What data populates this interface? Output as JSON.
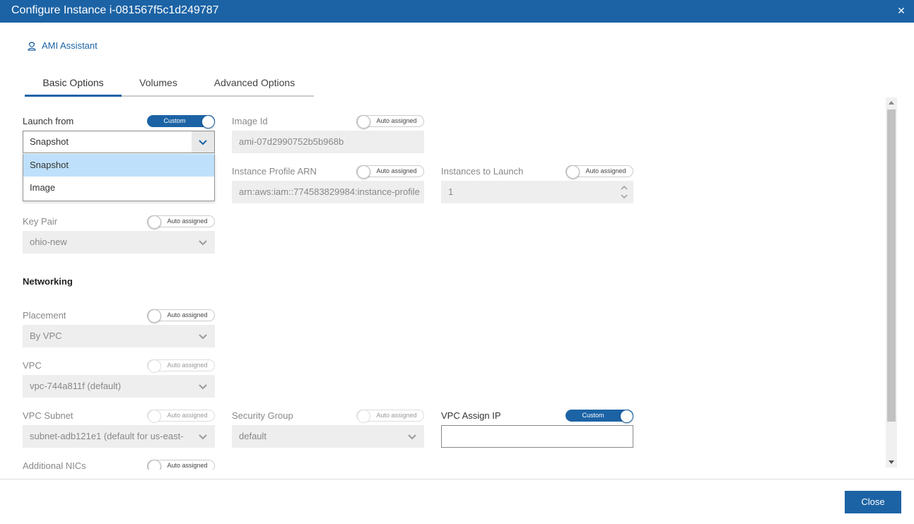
{
  "dialog": {
    "title": "Configure Instance i-081567f5c1d249787",
    "close_icon": "close-icon"
  },
  "ami_assistant": {
    "label": "AMI Assistant",
    "icon": "user-headset-icon"
  },
  "tabs": [
    {
      "label": "Basic Options",
      "active": true
    },
    {
      "label": "Volumes",
      "active": false
    },
    {
      "label": "Advanced Options",
      "active": false
    }
  ],
  "form": {
    "launch_from": {
      "label": "Launch from",
      "toggle": "Custom",
      "value": "Snapshot",
      "options": [
        "Snapshot",
        "Image"
      ],
      "selected_option": "Snapshot"
    },
    "image_id": {
      "label": "Image Id",
      "toggle": "Auto assigned",
      "value": "ami-07d2990752b5b968b"
    },
    "instance_profile_arn": {
      "label": "Instance Profile ARN",
      "toggle": "Auto assigned",
      "value": "arn:aws:iam::774583829984:instance-profile"
    },
    "instances_to_launch": {
      "label": "Instances to Launch",
      "toggle": "Auto assigned",
      "value": "1"
    },
    "key_pair": {
      "label": "Key Pair",
      "toggle": "Auto assigned",
      "value": "ohio-new"
    },
    "networking_heading": "Networking",
    "placement": {
      "label": "Placement",
      "toggle": "Auto assigned",
      "value": "By VPC"
    },
    "vpc": {
      "label": "VPC",
      "toggle": "Auto assigned",
      "value": "vpc-744a811f (default)"
    },
    "vpc_subnet": {
      "label": "VPC Subnet",
      "toggle": "Auto assigned",
      "value": "subnet-adb121e1 (default for us-east-"
    },
    "security_group": {
      "label": "Security Group",
      "toggle": "Auto assigned",
      "value": "default"
    },
    "vpc_assign_ip": {
      "label": "VPC Assign IP",
      "toggle": "Custom",
      "value": ""
    },
    "additional_nics": {
      "label": "Additional NICs",
      "toggle": "Auto assigned"
    }
  },
  "footer": {
    "close_label": "Close"
  },
  "colors": {
    "primary": "#1c63a5",
    "dropdown_selected": "#bfe0fb",
    "disabled_field": "#eeeeee"
  }
}
